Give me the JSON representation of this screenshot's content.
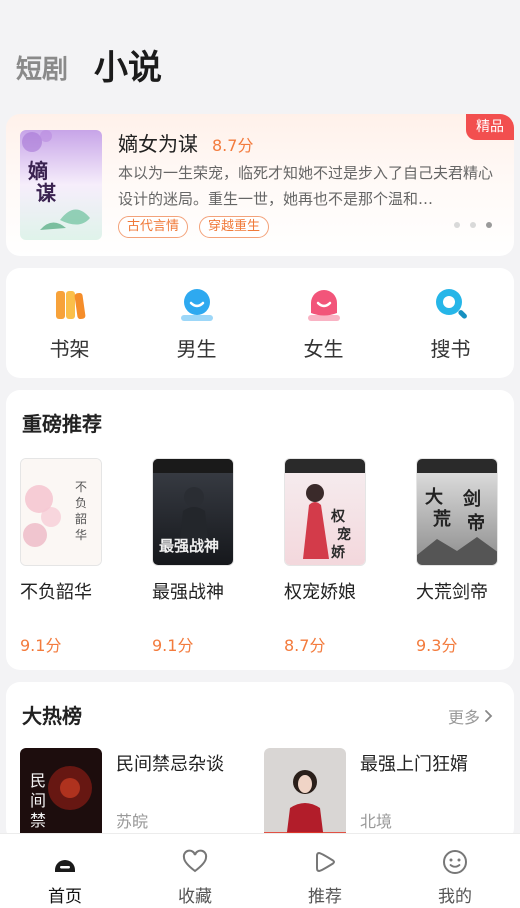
{
  "top_tabs": {
    "short_drama": "短剧",
    "novel": "小说"
  },
  "banner": {
    "badge": "精品",
    "title": "嫡女为谋",
    "score": "8.7分",
    "description": "本以为一生荣宠，临死才知她不过是步入了自己夫君精心设计的迷局。重生一世，她再也不是那个温和…",
    "tags": [
      "古代言情",
      "穿越重生"
    ]
  },
  "quick_entries": [
    {
      "label": "书架",
      "icon": "bookshelf-icon",
      "color": "#f7a23a"
    },
    {
      "label": "男生",
      "icon": "male-icon",
      "color": "#2ea9f0"
    },
    {
      "label": "女生",
      "icon": "female-icon",
      "color": "#f2557a"
    },
    {
      "label": "搜书",
      "icon": "search-icon",
      "color": "#26b6e8"
    }
  ],
  "recommend": {
    "title": "重磅推荐",
    "books": [
      {
        "title": "不负韶华",
        "score": "9.1分"
      },
      {
        "title": "最强战神",
        "score": "9.1分"
      },
      {
        "title": "权宠娇娘",
        "score": "8.7分"
      },
      {
        "title": "大荒剑帝",
        "score": "9.3分"
      }
    ]
  },
  "hot": {
    "title": "大热榜",
    "more": "更多",
    "books": [
      {
        "title": "民间禁忌杂谈",
        "author": "苏皖"
      },
      {
        "title": "最强上门狂婿",
        "author": "北境"
      }
    ]
  },
  "bottom_nav": [
    {
      "label": "首页",
      "icon": "home-icon",
      "active": true
    },
    {
      "label": "收藏",
      "icon": "heart-icon",
      "active": false
    },
    {
      "label": "推荐",
      "icon": "play-icon",
      "active": false
    },
    {
      "label": "我的",
      "icon": "smiley-icon",
      "active": false
    }
  ],
  "colors": {
    "accent": "#f37b3d",
    "badge": "#f24f4f",
    "page_bg": "#f3f3f5"
  }
}
